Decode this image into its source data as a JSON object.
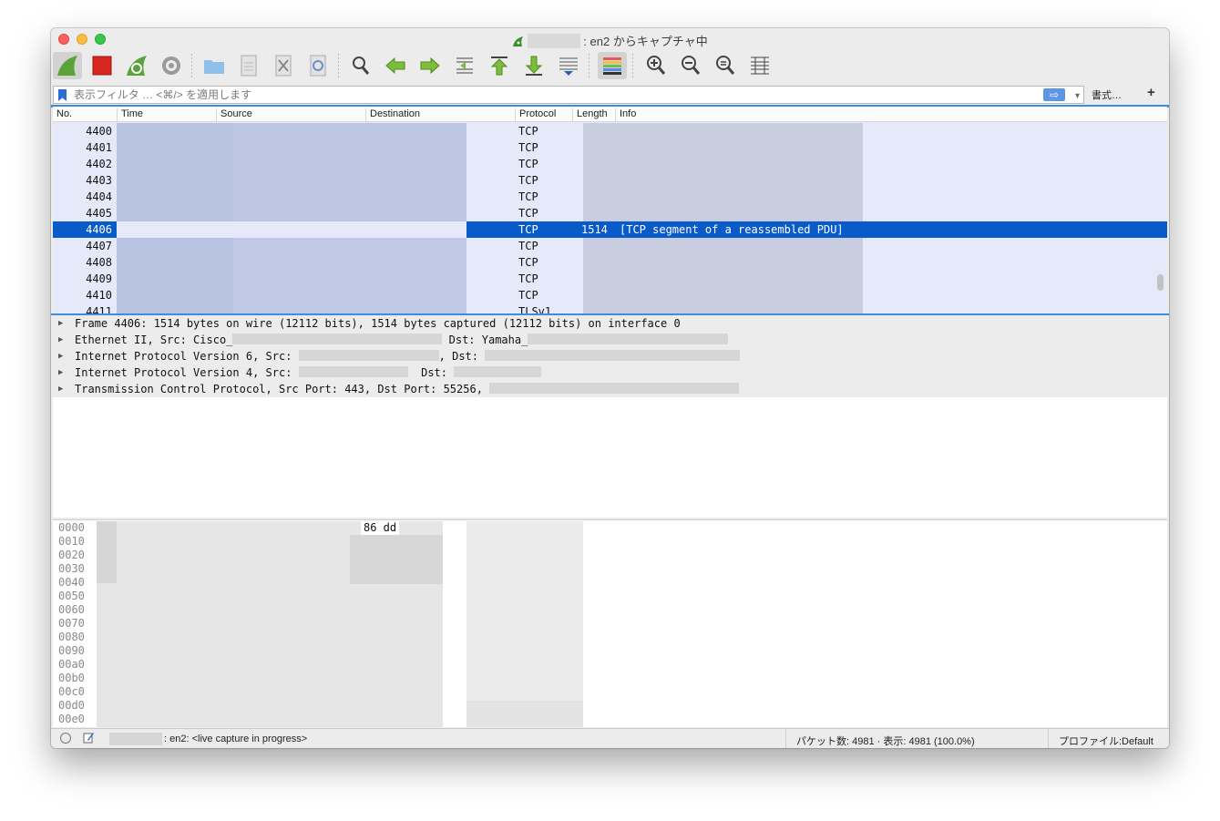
{
  "window": {
    "title": ": en2 からキャプチャ中"
  },
  "toolbar": {
    "buttons": [
      "start-capture-icon",
      "stop-capture-icon",
      "restart-capture-icon",
      "capture-options-icon",
      "open-file-icon",
      "save-file-icon",
      "close-file-icon",
      "reload-file-icon",
      "find-packet-icon",
      "go-back-icon",
      "go-forward-icon",
      "go-to-packet-icon",
      "first-packet-icon",
      "last-packet-icon",
      "autoscroll-icon",
      "colorize-icon",
      "zoom-in-icon",
      "zoom-out-icon",
      "normal-size-icon",
      "resize-columns-icon"
    ]
  },
  "filter": {
    "placeholder": "表示フィルタ … <⌘/> を適用します",
    "apply_label": "⇨",
    "format_label": "書式…",
    "add_label": "+"
  },
  "packet_list": {
    "columns": [
      "No.",
      "Time",
      "Source",
      "Destination",
      "Protocol",
      "Length",
      "Info"
    ],
    "rows": [
      {
        "no": "4400",
        "protocol": "TCP",
        "length": "",
        "info": ""
      },
      {
        "no": "4401",
        "protocol": "TCP",
        "length": "",
        "info": ""
      },
      {
        "no": "4402",
        "protocol": "TCP",
        "length": "",
        "info": ""
      },
      {
        "no": "4403",
        "protocol": "TCP",
        "length": "",
        "info": ""
      },
      {
        "no": "4404",
        "protocol": "TCP",
        "length": "",
        "info": ""
      },
      {
        "no": "4405",
        "protocol": "TCP",
        "length": "",
        "info": ""
      },
      {
        "no": "4406",
        "protocol": "TCP",
        "length": "1514",
        "info": "[TCP segment of a reassembled PDU]"
      },
      {
        "no": "4407",
        "protocol": "TCP",
        "length": "",
        "info": ""
      },
      {
        "no": "4408",
        "protocol": "TCP",
        "length": "",
        "info": ""
      },
      {
        "no": "4409",
        "protocol": "TCP",
        "length": "",
        "info": ""
      },
      {
        "no": "4410",
        "protocol": "TCP",
        "length": "",
        "info": ""
      },
      {
        "no": "4411",
        "protocol": "TLSv1",
        "length": "",
        "info": ""
      }
    ]
  },
  "details": {
    "frame": "Frame 4406: 1514 bytes on wire (12112 bits), 1514 bytes captured (12112 bits) on interface 0",
    "eth_prefix": "Ethernet II, Src: Cisco_",
    "eth_dst": "Dst: Yamaha_",
    "ipv6_prefix": "Internet Protocol Version 6, Src:",
    "ipv6_dst": ", Dst:",
    "ipv4_prefix": "Internet Protocol Version 4, Src:",
    "ipv4_dst": "Dst:",
    "tcp_prefix": "Transmission Control Protocol, Src Port: 443, Dst Port: 55256,"
  },
  "bytes": {
    "offsets": [
      "0000",
      "0010",
      "0020",
      "0030",
      "0040",
      "0050",
      "0060",
      "0070",
      "0080",
      "0090",
      "00a0",
      "00b0",
      "00c0",
      "00d0",
      "00e0"
    ],
    "selected_hex": "86 dd"
  },
  "status": {
    "capture_text": ": en2: <live capture in progress>",
    "packets_text": "パケット数: 4981 · 表示: 4981 (100.0%)",
    "profile_text": "プロファイル:Default"
  },
  "colors": {
    "selected_row": "#0a5bca",
    "list_background": "#e6e9f9",
    "accent_blue": "#3b8de0"
  }
}
